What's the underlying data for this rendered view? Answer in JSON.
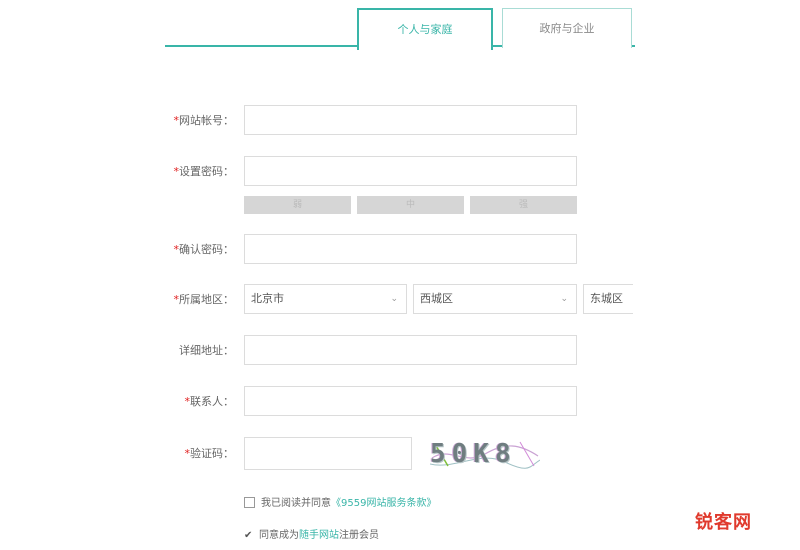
{
  "tabs": {
    "personal": "个人与家庭",
    "company": "政府与企业"
  },
  "form": {
    "account": {
      "label": "网站帐号：",
      "required": "*",
      "value": ""
    },
    "password": {
      "label": "设置密码：",
      "required": "*",
      "value": ""
    },
    "strength": [
      "弱",
      "中",
      "强"
    ],
    "confirm": {
      "label": "确认密码：",
      "required": "*",
      "value": ""
    },
    "region": {
      "label": "所属地区：",
      "required": "*",
      "province": "北京市",
      "district": "西城区",
      "third": "东城区"
    },
    "address": {
      "label": "详细地址：",
      "required": "",
      "value": ""
    },
    "contact": {
      "label": "联系人：",
      "required": "*",
      "value": ""
    },
    "captcha": {
      "label": "验证码：",
      "required": "*",
      "value": "",
      "image_text": "50K8"
    },
    "agree": {
      "text": "我已阅读并同意",
      "link": "《9559网站服务条款》"
    },
    "member": {
      "prefix": "同意成为",
      "link": "随手网站",
      "suffix": "注册会员"
    }
  },
  "watermark": "锐客网",
  "colors": {
    "accent": "#39b5a8",
    "required": "#e02020",
    "watermark": "#e03a2d"
  }
}
